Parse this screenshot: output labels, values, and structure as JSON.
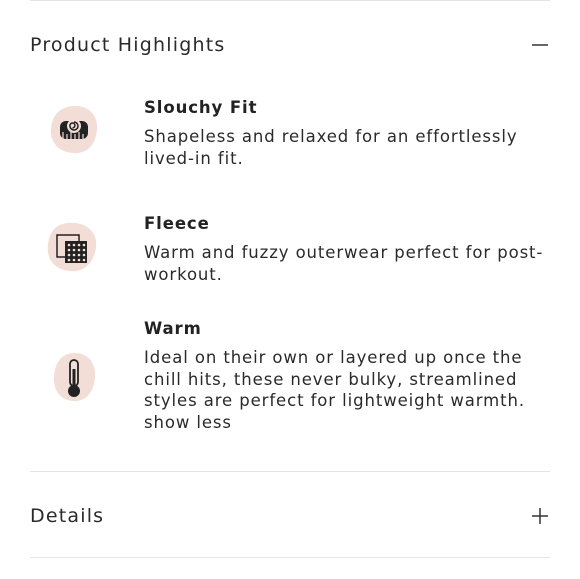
{
  "sections": {
    "highlights": {
      "title": "Product Highlights",
      "toggle_icon": "minus-icon",
      "expanded": true
    },
    "details": {
      "title": "Details",
      "toggle_icon": "plus-icon",
      "expanded": false
    }
  },
  "highlights": [
    {
      "icon": "measuring-tape-icon",
      "title": "Slouchy Fit",
      "description": "Shapeless and relaxed for an effortlessly lived-in fit."
    },
    {
      "icon": "fleece-fabric-icon",
      "title": "Fleece",
      "description": "Warm and fuzzy outerwear perfect for post-workout."
    },
    {
      "icon": "thermometer-icon",
      "title": "Warm",
      "description": "Ideal on their own or layered up once the chill hits, these never bulky, streamlined styles are perfect for lightweight warmth."
    }
  ],
  "show_less_label": "show less",
  "colors": {
    "icon_blob": "#f2ded6",
    "divider": "#e4e4e4",
    "text": "#222222"
  }
}
